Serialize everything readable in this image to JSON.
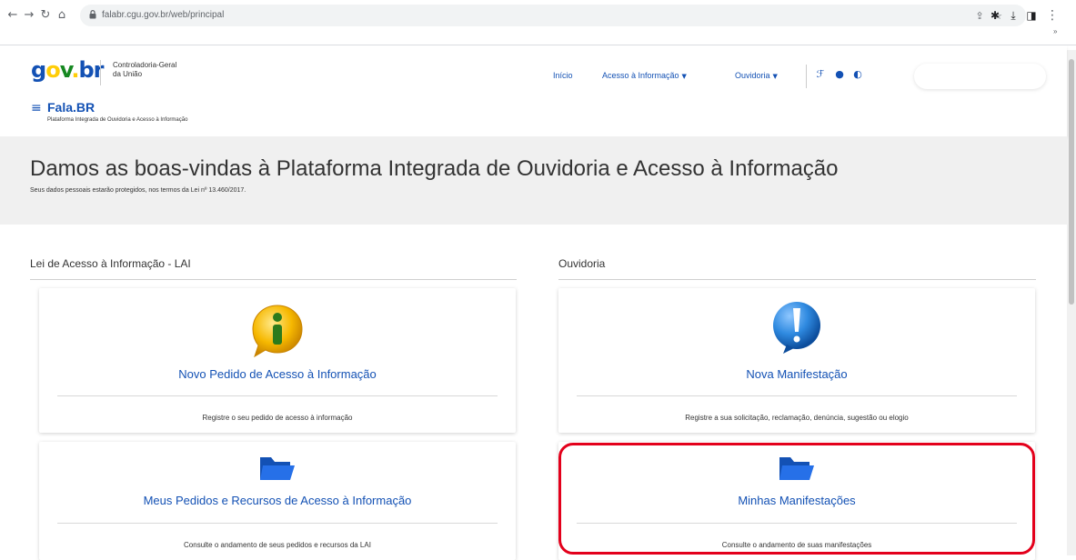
{
  "browser": {
    "url": "falabr.cgu.gov.br/web/principal",
    "back_icon": "back-arrow-icon",
    "forward_icon": "forward-arrow-icon",
    "reload_icon": "reload-icon",
    "home_icon": "home-icon"
  },
  "header": {
    "logo": {
      "g": "g",
      "o": "o",
      "v": "v",
      "dot": ".",
      "br": "br"
    },
    "org_line1": "Controladoria-Geral",
    "org_line2": "da União",
    "app_name": "Fala.BR",
    "app_subtitle": "Plataforma Integrada de Ouvidoria e Acesso à Informação",
    "nav": [
      {
        "label": "Início"
      },
      {
        "label": "Acesso à Informação"
      },
      {
        "label": "Ouvidoria"
      }
    ]
  },
  "banner": {
    "title": "Damos as boas-vindas à Plataforma Integrada de Ouvidoria e Acesso à Informação",
    "subtitle": "Seus dados pessoais estarão protegidos, nos termos da Lei nº 13.460/2017."
  },
  "sections": {
    "lai": {
      "title": "Lei de Acesso à Informação - LAI",
      "cards": [
        {
          "title": "Novo Pedido de Acesso à Informação",
          "desc": "Registre o seu pedido de acesso à informação",
          "icon": "info-icon"
        },
        {
          "title": "Meus Pedidos e Recursos de Acesso à Informação",
          "desc": "Consulte o andamento de seus pedidos e recursos da LAI",
          "icon": "folder-icon"
        }
      ]
    },
    "ouvidoria": {
      "title": "Ouvidoria",
      "cards": [
        {
          "title": "Nova Manifestação",
          "desc": "Registre a sua solicitação, reclamação, denúncia, sugestão ou elogio",
          "icon": "exclamation-icon"
        },
        {
          "title": "Minhas Manifestações",
          "desc": "Consulte o andamento de suas manifestações",
          "icon": "folder-icon"
        }
      ]
    }
  },
  "colors": {
    "brand_blue": "#1351b4",
    "highlight_red": "#e3001b",
    "banner_bg": "#f0f0f0"
  }
}
